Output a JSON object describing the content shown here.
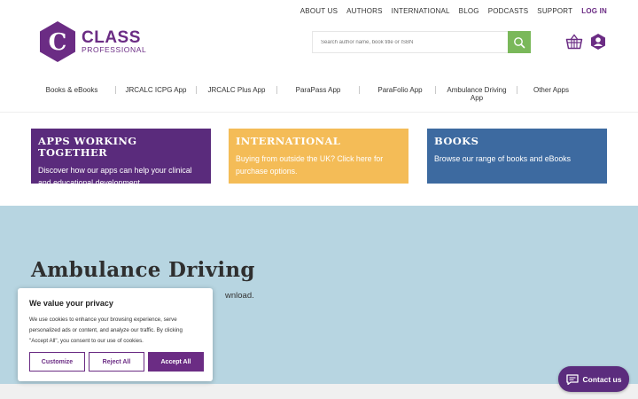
{
  "top_nav": [
    "ABOUT US",
    "AUTHORS",
    "INTERNATIONAL",
    "BLOG",
    "PODCASTS",
    "SUPPORT"
  ],
  "login_label": "LOG IN",
  "logo": {
    "letter": "C",
    "line1": "CLASS",
    "line2": "PROFESSIONAL"
  },
  "search": {
    "placeholder": "Search author name, book title or ISBN"
  },
  "main_menu": [
    "Books & eBooks",
    "JRCALC ICPG App",
    "JRCALC Plus App",
    "ParaPass App",
    "ParaFolio App",
    "Ambulance Driving App",
    "Other Apps"
  ],
  "cards": {
    "apps": {
      "title": "APPS WORKING TOGETHER",
      "text": "Discover how our apps can help your clinical and educational development."
    },
    "international": {
      "title": "INTERNATIONAL",
      "text": "Buying from outside the UK? Click here for purchase options."
    },
    "books": {
      "title": "BOOKS",
      "text": "Browse our range of books and eBooks"
    }
  },
  "hero": {
    "title": "Ambulance Driving",
    "subtitle_visible": "wnload."
  },
  "cookie": {
    "title": "We value your privacy",
    "text": "We use cookies to enhance your browsing experience, serve personalized ads or content, and analyze our traffic. By clicking \"Accept All\", you consent to our use of cookies.",
    "customize": "Customize",
    "reject": "Reject All",
    "accept": "Accept All"
  },
  "contact_label": "Contact us",
  "colors": {
    "brand_purple": "#6b2c84",
    "search_green": "#7ab85a",
    "apps_card": "#5a2b7c",
    "international_card": "#f4bc57",
    "books_card": "#3d6aa0",
    "hero_bg": "#b7d5e1"
  }
}
